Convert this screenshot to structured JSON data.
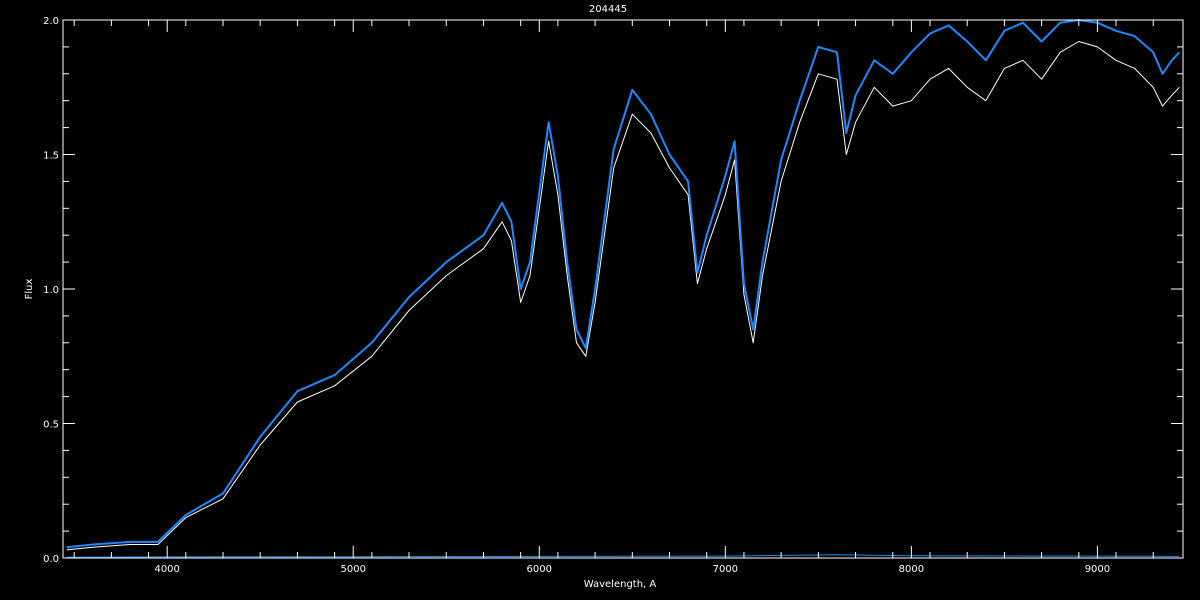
{
  "chart_data": {
    "type": "line",
    "title": "204445",
    "xlabel": "Wavelength, A",
    "ylabel": "Flux",
    "xlim": [
      3440,
      9460
    ],
    "ylim": [
      0,
      2.0
    ],
    "xticks": [
      4000,
      5000,
      6000,
      7000,
      8000,
      9000
    ],
    "yticks": [
      0.0,
      0.5,
      1.0,
      1.5,
      2.0
    ],
    "ytick_labels": [
      "0.0",
      "0.5",
      "1.0",
      "1.5",
      "2.0"
    ],
    "grid": false,
    "background": "#000000",
    "axis_color": "#ffffff",
    "series": [
      {
        "color": "#ffffff",
        "x": [
          3460,
          3600,
          3800,
          3950,
          4100,
          4300,
          4500,
          4700,
          4900,
          5100,
          5300,
          5500,
          5700,
          5800,
          5850,
          5900,
          5950,
          6050,
          6100,
          6150,
          6200,
          6250,
          6300,
          6400,
          6500,
          6600,
          6700,
          6800,
          6850,
          6900,
          7000,
          7050,
          7100,
          7150,
          7200,
          7300,
          7400,
          7500,
          7600,
          7650,
          7700,
          7800,
          7900,
          8000,
          8100,
          8200,
          8300,
          8400,
          8500,
          8600,
          8700,
          8800,
          8900,
          9000,
          9100,
          9200,
          9300,
          9350,
          9400,
          9440
        ],
        "values": [
          0.03,
          0.04,
          0.05,
          0.05,
          0.15,
          0.22,
          0.42,
          0.58,
          0.64,
          0.75,
          0.92,
          1.05,
          1.15,
          1.25,
          1.18,
          0.95,
          1.05,
          1.55,
          1.35,
          1.05,
          0.8,
          0.75,
          0.95,
          1.45,
          1.65,
          1.58,
          1.45,
          1.35,
          1.02,
          1.15,
          1.35,
          1.48,
          0.98,
          0.8,
          1.05,
          1.4,
          1.62,
          1.8,
          1.78,
          1.5,
          1.62,
          1.75,
          1.68,
          1.7,
          1.78,
          1.82,
          1.75,
          1.7,
          1.82,
          1.85,
          1.78,
          1.88,
          1.92,
          1.9,
          1.85,
          1.82,
          1.75,
          1.68,
          1.72,
          1.75
        ]
      },
      {
        "color": "#1e88ff",
        "x": [
          3460,
          3600,
          3800,
          3950,
          4100,
          4300,
          4500,
          4700,
          4900,
          5100,
          5300,
          5500,
          5700,
          5800,
          5850,
          5900,
          5950,
          6050,
          6100,
          6150,
          6200,
          6250,
          6300,
          6400,
          6500,
          6600,
          6700,
          6800,
          6850,
          6900,
          7000,
          7050,
          7100,
          7150,
          7200,
          7300,
          7400,
          7500,
          7600,
          7650,
          7700,
          7800,
          7900,
          8000,
          8100,
          8200,
          8300,
          8400,
          8500,
          8600,
          8700,
          8800,
          8900,
          9000,
          9100,
          9200,
          9300,
          9350,
          9400,
          9440
        ],
        "values": [
          0.04,
          0.05,
          0.06,
          0.06,
          0.16,
          0.24,
          0.45,
          0.62,
          0.68,
          0.8,
          0.97,
          1.1,
          1.2,
          1.32,
          1.25,
          1.0,
          1.1,
          1.62,
          1.42,
          1.1,
          0.85,
          0.78,
          1.0,
          1.52,
          1.74,
          1.65,
          1.5,
          1.4,
          1.06,
          1.2,
          1.42,
          1.55,
          1.02,
          0.85,
          1.1,
          1.48,
          1.7,
          1.9,
          1.88,
          1.58,
          1.72,
          1.85,
          1.8,
          1.88,
          1.95,
          1.98,
          1.92,
          1.85,
          1.96,
          1.99,
          1.92,
          1.99,
          2.0,
          1.99,
          1.96,
          1.94,
          1.88,
          1.8,
          1.85,
          1.88
        ]
      },
      {
        "color": "#1e88ff",
        "x": [
          3460,
          4000,
          5000,
          6000,
          7000,
          7600,
          8000,
          9000,
          9440
        ],
        "values": [
          0.003,
          0.004,
          0.005,
          0.006,
          0.007,
          0.012,
          0.008,
          0.007,
          0.006
        ]
      }
    ]
  }
}
